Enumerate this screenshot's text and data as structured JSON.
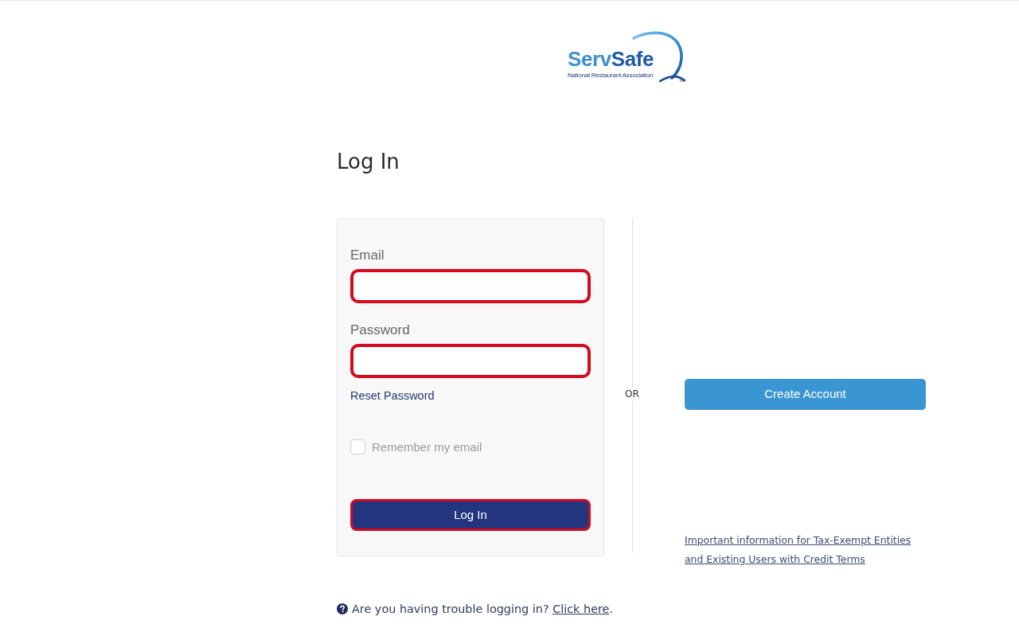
{
  "logo": {
    "wordmark": [
      "Serv",
      "Safe"
    ],
    "tagline": "National Restaurant Association",
    "trademark": "™"
  },
  "heading": "Log In",
  "login_form": {
    "fields": [
      {
        "label": "Email",
        "highlighted": true
      },
      {
        "label": "Password",
        "highlighted": true
      }
    ],
    "reset_link": "Reset Password",
    "remember": {
      "label": "Remember my email",
      "checked": false
    },
    "submit": {
      "label": "Log In",
      "highlighted": true
    }
  },
  "separator": "OR",
  "create_account": {
    "label": "Create Account",
    "highlighted": false
  },
  "tax_info_link": "Important information for Tax-Exempt Entities and Existing Users with Credit Terms",
  "help": {
    "text": "Are you having trouble logging in?",
    "link": "Click here",
    "end": "."
  }
}
